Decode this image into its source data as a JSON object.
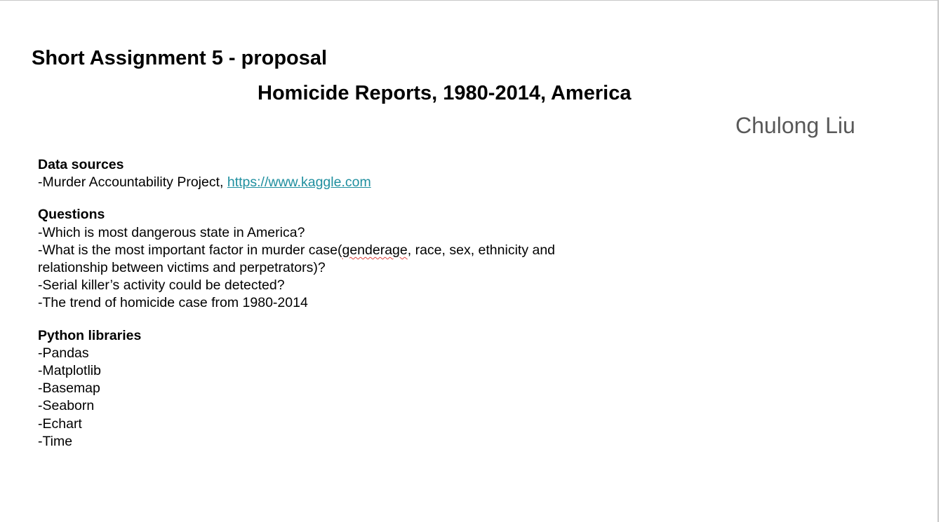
{
  "slide": {
    "title": "Short Assignment 5 - proposal",
    "subtitle": "Homicide Reports, 1980-2014, America",
    "author": "Chulong Liu"
  },
  "data_sources": {
    "heading": "Data sources",
    "item_prefix": "-Murder Accountability Project, ",
    "link_text": "https://www.kaggle.com"
  },
  "questions": {
    "heading": "Questions",
    "q1": "-Which is most dangerous state in America?",
    "q2_before": "-What is the most important factor in murder case(",
    "q2_flagged_word": "genderage",
    "q2_after": ", race, sex, ethnicity and",
    "q2_cont": "relationship between victims and perpetrators)?",
    "q3": "-Serial killer’s activity could be detected?",
    "q4": "-The trend of homicide case from 1980-2014"
  },
  "libraries": {
    "heading": "Python libraries",
    "items": [
      "-Pandas",
      "-Matplotlib",
      "-Basemap",
      "-Seaborn",
      "-Echart",
      "-Time"
    ]
  },
  "colors": {
    "link": "#1f8f9f",
    "author": "#595959",
    "spellcheck": "#e0443f"
  }
}
